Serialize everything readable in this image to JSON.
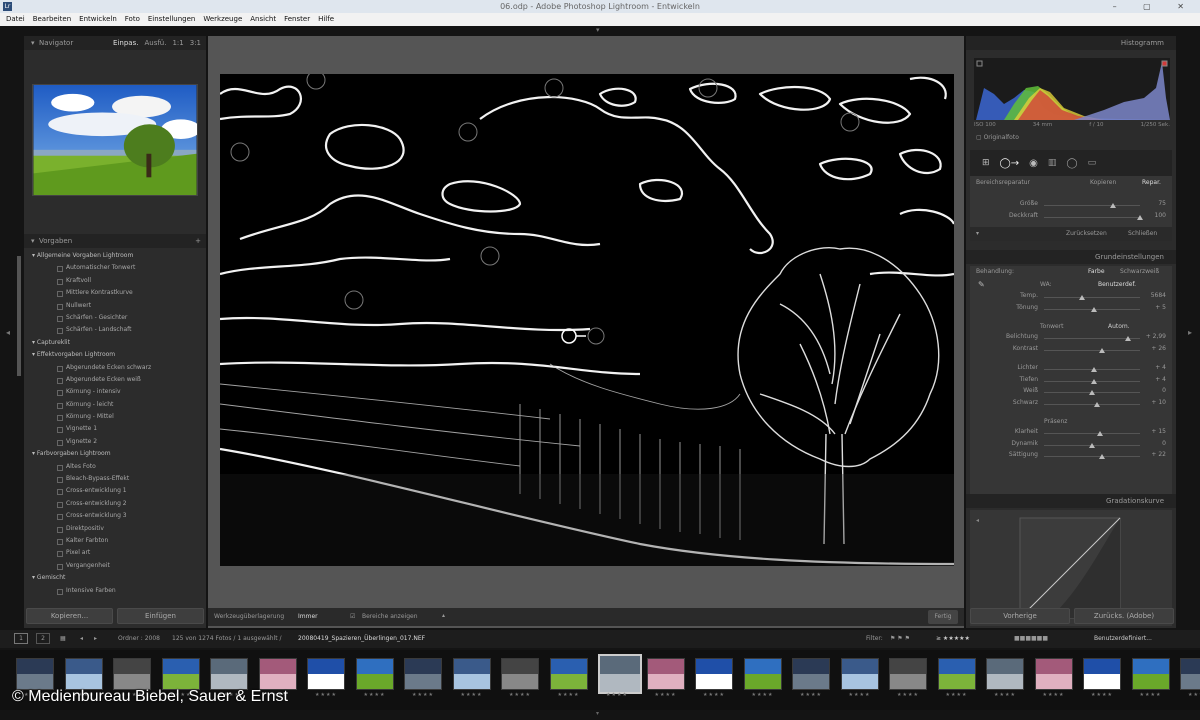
{
  "window": {
    "title": "06.odp - Adobe Photoshop Lightroom - Entwickeln",
    "buttons": "– ▢ ✕"
  },
  "menu": [
    "Datei",
    "Bearbeiten",
    "Entwickeln",
    "Foto",
    "Einstellungen",
    "Werkzeuge",
    "Ansicht",
    "Fenster",
    "Hilfe"
  ],
  "left": {
    "navigator": {
      "title": "Navigator",
      "modes": [
        "Einpas.",
        "Ausfü.",
        "1:1",
        "3:1"
      ]
    },
    "presets": {
      "title": "Vorgaben",
      "items": [
        {
          "t": "group",
          "label": "Allgemeine Vorgaben Lightroom"
        },
        {
          "t": "child",
          "label": "Automatischer Tonwert"
        },
        {
          "t": "child",
          "label": "Kraftvoll"
        },
        {
          "t": "child",
          "label": "Mittlere Kontrastkurve"
        },
        {
          "t": "child",
          "label": "Nullwert"
        },
        {
          "t": "child",
          "label": "Schärfen - Gesichter"
        },
        {
          "t": "child",
          "label": "Schärfen - Landschaft"
        },
        {
          "t": "group",
          "label": "Captureklit"
        },
        {
          "t": "group",
          "label": "Effektvorgaben Lightroom"
        },
        {
          "t": "child",
          "label": "Abgerundete Ecken schwarz"
        },
        {
          "t": "child",
          "label": "Abgerundete Ecken weiß"
        },
        {
          "t": "child",
          "label": "Körnung - intensiv"
        },
        {
          "t": "child",
          "label": "Körnung - leicht"
        },
        {
          "t": "child",
          "label": "Körnung - Mittel"
        },
        {
          "t": "child",
          "label": "Vignette 1"
        },
        {
          "t": "child",
          "label": "Vignette 2"
        },
        {
          "t": "group",
          "label": "Farbvorgaben Lightroom"
        },
        {
          "t": "child",
          "label": "Altes Foto"
        },
        {
          "t": "child",
          "label": "Bleach-Bypass-Effekt"
        },
        {
          "t": "child",
          "label": "Cross-entwicklung 1"
        },
        {
          "t": "child",
          "label": "Cross-entwicklung 2"
        },
        {
          "t": "child",
          "label": "Cross-entwicklung 3"
        },
        {
          "t": "child",
          "label": "Direktpositiv"
        },
        {
          "t": "child",
          "label": "Kalter Farbton"
        },
        {
          "t": "child",
          "label": "Pixel art"
        },
        {
          "t": "child",
          "label": "Vergangenheit"
        },
        {
          "t": "group",
          "label": "Gemischt"
        },
        {
          "t": "child",
          "label": "Intensive Farben"
        }
      ]
    },
    "buttons": {
      "copy": "Kopieren...",
      "paste": "Einfügen"
    }
  },
  "toolbar": {
    "label": "Werkzeugüberlagerung",
    "mode": "Immer",
    "checkbox": "Bereiche anzeigen",
    "done": "Fertig"
  },
  "right": {
    "histogram": {
      "title": "Histogramm",
      "iso": "ISO 100",
      "focal": "34 mm",
      "aperture": "f / 10",
      "shutter": "1/250 Sek.",
      "original": "Originalfoto"
    },
    "spot": {
      "label": "Bereichsreparatur",
      "mode1": "Kopieren",
      "mode2": "Repar.",
      "sliders": [
        {
          "label": "Größe",
          "val": "75",
          "pos": 0.72
        },
        {
          "label": "Deckkraft",
          "val": "100",
          "pos": 1.0
        }
      ],
      "tool1": "Zurücksetzen",
      "tool2": "Schließen"
    },
    "basic": {
      "title": "Grundeinstellungen",
      "behandlung": "Behandlung:",
      "farbe": "Farbe",
      "sw": "Schwarzweiß",
      "wb_label": "WA:",
      "wb_value": "Benutzerdef.",
      "group1": [
        {
          "label": "Temp.",
          "val": "5684",
          "pos": 0.4
        },
        {
          "label": "Tönung",
          "val": "+ 5",
          "pos": 0.52
        }
      ],
      "tone_title": "Tonwert",
      "tone_auto": "Autom.",
      "group2": [
        {
          "label": "Belichtung",
          "val": "+ 2,99",
          "pos": 0.88
        },
        {
          "label": "Kontrast",
          "val": "+ 26",
          "pos": 0.6
        }
      ],
      "group3": [
        {
          "label": "Lichter",
          "val": "+ 4",
          "pos": 0.52
        },
        {
          "label": "Tiefen",
          "val": "+ 4",
          "pos": 0.52
        },
        {
          "label": "Weiß",
          "val": "0",
          "pos": 0.5
        },
        {
          "label": "Schwarz",
          "val": "+ 10",
          "pos": 0.55
        }
      ],
      "presence_title": "Präsenz",
      "group4": [
        {
          "label": "Klarheit",
          "val": "+ 15",
          "pos": 0.58
        },
        {
          "label": "Dynamik",
          "val": "0",
          "pos": 0.5
        },
        {
          "label": "Sättigung",
          "val": "+ 22",
          "pos": 0.6
        }
      ]
    },
    "curve": {
      "title": "Gradationskurve"
    },
    "buttons": {
      "prev": "Vorherige",
      "reset": "Zurücks. (Adobe)"
    }
  },
  "filmbar": {
    "views": [
      "1",
      "2"
    ],
    "source": "Ordner : 2008",
    "count": "125 von 1274 Fotos / 1 ausgewählt /",
    "filename": "20080419_Spazieren_Überlingen_017.NEF",
    "filter": "Filter:",
    "preset": "Benutzerdefiniert..."
  },
  "copyright": "© Medienbureau Biebel, Sauer & Ernst",
  "colors": {
    "histogram_blue": "#3a63c9",
    "histogram_green": "#5fbf3a",
    "histogram_yellow": "#e0cf3a",
    "histogram_red": "#d23a3a"
  }
}
